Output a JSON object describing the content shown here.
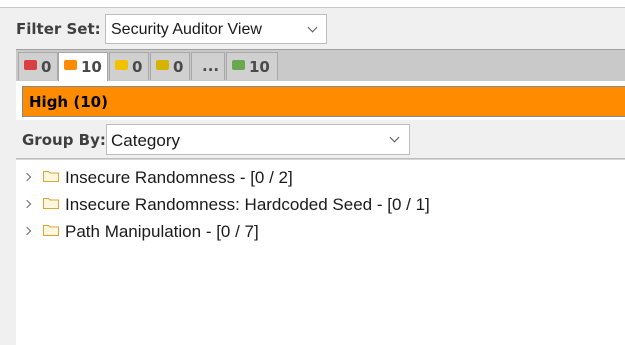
{
  "filter": {
    "label": "Filter Set:",
    "value": "Security Auditor View"
  },
  "priority_tabs": [
    {
      "name": "critical",
      "color": "#d94040",
      "count": "0"
    },
    {
      "name": "high",
      "color": "#ff8c00",
      "count": "10"
    },
    {
      "name": "medium",
      "color": "#f2c200",
      "count": "0"
    },
    {
      "name": "low",
      "color": "#d4b400",
      "count": "0"
    },
    {
      "name": "more",
      "label": "..."
    },
    {
      "name": "all",
      "color": "#6aa84f",
      "count": "10"
    }
  ],
  "severity": {
    "label": "High (10)",
    "color": "#ff8c00"
  },
  "group_by": {
    "label": "Group By:",
    "value": "Category"
  },
  "tree": [
    {
      "label": "Insecure Randomness - [0 / 2]"
    },
    {
      "label": "Insecure Randomness: Hardcoded Seed - [0 / 1]"
    },
    {
      "label": "Path Manipulation - [0 / 7]"
    }
  ]
}
